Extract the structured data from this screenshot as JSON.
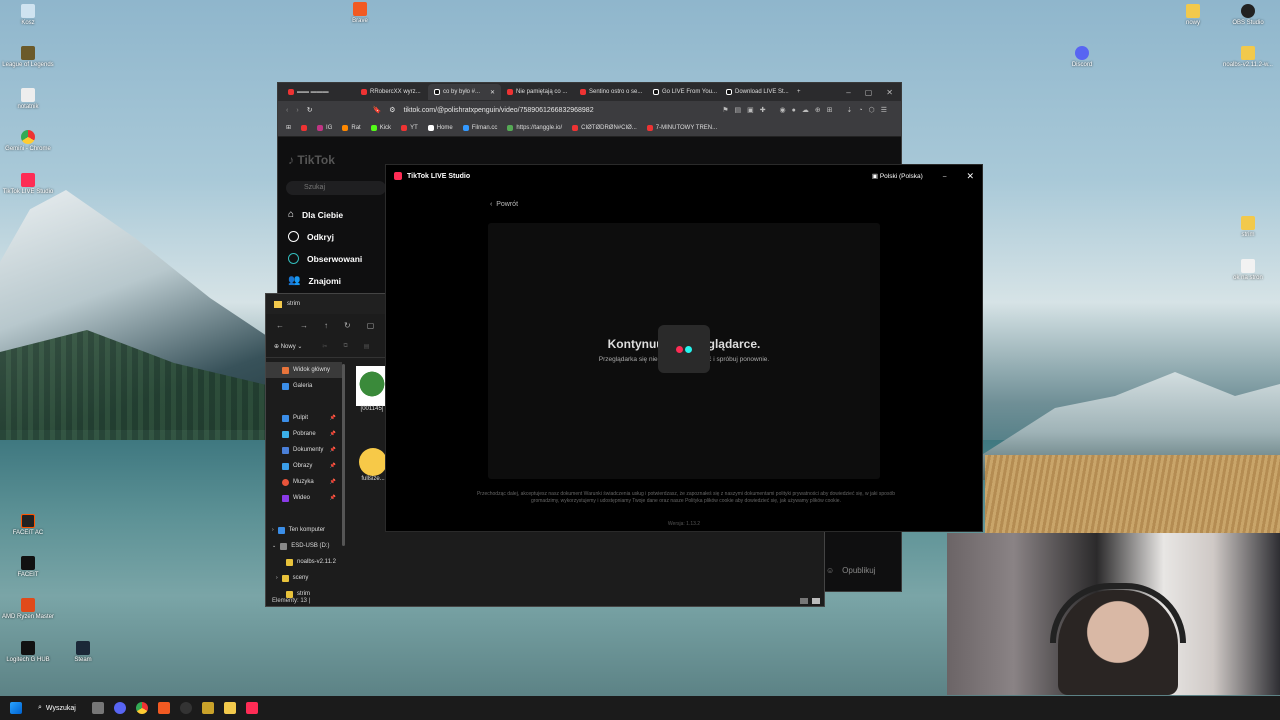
{
  "desktop": {
    "icons_left": [
      "Kosz",
      "League of Legends",
      "notatnik",
      "Gemini - Chrome",
      "TikTok LIVE Studio",
      "FACEIT AC",
      "FACEIT",
      "AMD Ryzen Master",
      "Logitech G HUB",
      "Steam"
    ],
    "icons_top": [
      "Brave"
    ],
    "icons_right": [
      "Discord",
      "nowy",
      "OBS Studio",
      "noalbs-v2.11.2-w...",
      "strim",
      "ok na stron"
    ]
  },
  "browser": {
    "tabs": [
      "RRobercXX wyrz...",
      "co by było #...",
      "Nie pamiętają co ...",
      "Sentino ostro o se...",
      "Go LIVE From You...",
      "Download LIVE St..."
    ],
    "url": "tiktok.com/@polishratxpenguin/video/7589061266832968982",
    "bookmarks": [
      "IG",
      "Rat",
      "Kick",
      "YT",
      "Home",
      "Filman.cc",
      "https://tanggle.io/",
      "CIØTØDRØN#CIØ...",
      "7-MINUTOWY TREN..."
    ],
    "tiktok": {
      "search_placeholder": "Szukaj",
      "nav": [
        "Dla Ciebie",
        "Odkryj",
        "Obserwowani",
        "Znajomi"
      ]
    }
  },
  "explorer": {
    "title": "strim",
    "new_label": "Nowy",
    "nav_items": [
      {
        "label": "Widok główny",
        "color": "#e8743b"
      },
      {
        "label": "Galeria",
        "color": "#3b8ee8"
      },
      {
        "label": "Pulpit",
        "color": "#3b8ee8"
      },
      {
        "label": "Pobrane",
        "color": "#3bb0e8"
      },
      {
        "label": "Dokumenty",
        "color": "#4a7fd8"
      },
      {
        "label": "Obrazy",
        "color": "#3b9ee8"
      },
      {
        "label": "Muzyka",
        "color": "#e8543b"
      },
      {
        "label": "Wideo",
        "color": "#8a3be8"
      },
      {
        "label": "Ten komputer",
        "color": "#3b8ee8"
      },
      {
        "label": "ESD-USB (D:)",
        "color": "#888888"
      },
      {
        "label": "noalbs-v2.11.2",
        "color": "#e8c23b"
      },
      {
        "label": "sceny",
        "color": "#e8c23b"
      },
      {
        "label": "strim",
        "color": "#e8c23b"
      }
    ],
    "files": [
      "[001145]",
      "fullsize..."
    ],
    "status": "Elementy: 13"
  },
  "studio": {
    "title": "TikTok LIVE Studio",
    "language": "Polski (Polska)",
    "back": "Powrót",
    "heading_left": "Kontynuu",
    "heading_right": "glądarce.",
    "sub_left": "Przeglądarka się nie w",
    "sub_right": "ć i spróbuj ponownie.",
    "terms": "Przechodząc dalej, akceptujesz nasz dokument Warunki świadczenia usług i potwierdzasz, że zapoznałeś się z naszymi dokumentami polityki prywatności aby dowiedzieć się, w jaki sposób gromadzimy, wykorzystujemy i udostępniamy Twoje dane oraz nasze Polityka plików cookie aby dowiedzieć się, jak używamy plików cookie.",
    "version": "Wersja: 1.13.2"
  },
  "publish_label": "Opublikuj",
  "taskbar": {
    "search": "Wyszukaj"
  }
}
